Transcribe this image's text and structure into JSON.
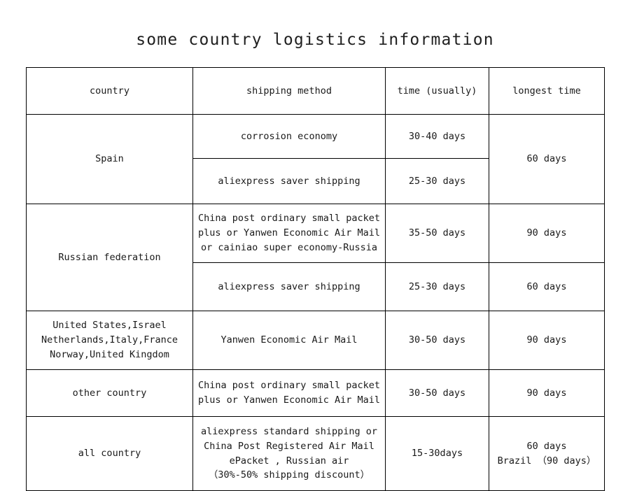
{
  "page": {
    "title": "some country logistics information",
    "background_color": "#ffffff",
    "text_color": "#1a1a1a",
    "border_color": "#000000"
  },
  "table": {
    "headers": {
      "country": "country",
      "shipping_method": "shipping method",
      "time_usually": "time (usually)",
      "longest_time": "longest time"
    },
    "rows": [
      {
        "country": "Spain",
        "longest_time": "60 days",
        "methods": [
          {
            "shipping_method": "corrosion economy",
            "time": "30-40 days"
          },
          {
            "shipping_method": "aliexpress saver shipping",
            "time": "25-30 days"
          }
        ]
      },
      {
        "country": "Russian federation",
        "methods": [
          {
            "shipping_method": "China post ordinary small packet\nplus or Yanwen Economic Air Mail\nor cainiao super economy-Russia",
            "time": "35-50 days",
            "longest_time": "90 days"
          },
          {
            "shipping_method": "aliexpress saver shipping",
            "time": "25-30 days",
            "longest_time": "60 days"
          }
        ]
      },
      {
        "country": "United States,Israel\nNetherlands,Italy,France\nNorway,United Kingdom",
        "shipping_method": "Yanwen Economic Air Mail",
        "time": "30-50 days",
        "longest_time": "90 days"
      },
      {
        "country": "other country",
        "shipping_method": "China post ordinary small packet\nplus or Yanwen Economic Air Mail",
        "time": "30-50 days",
        "longest_time": "90 days"
      },
      {
        "country": "all  country",
        "shipping_method": "aliexpress standard shipping or\nChina Post Registered Air Mail\nePacket , Russian air\n（30%-50% shipping discount）",
        "time": "15-30days",
        "longest_time": "60 days\nBrazil （90 days）"
      }
    ]
  }
}
